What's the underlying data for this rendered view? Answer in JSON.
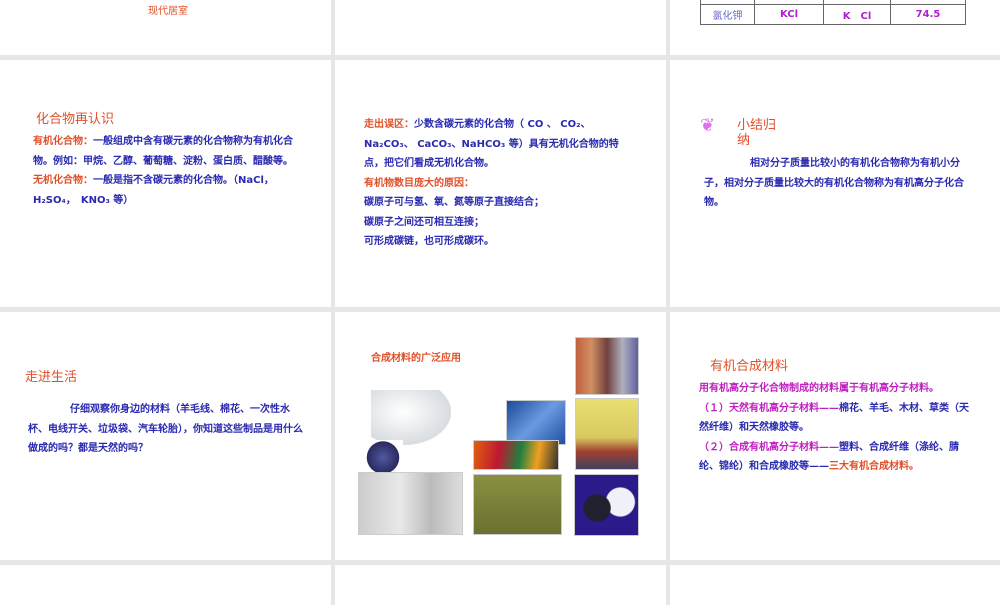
{
  "slide_top_left": {
    "caption": "现代居室"
  },
  "slide_top_right": {
    "table_row": [
      "氯化钾",
      "KCl",
      "K　Cl",
      "74.5"
    ]
  },
  "slide_compounds": {
    "title": "化合物再认识",
    "organic_label": "有机化合物：",
    "organic_text": "一般组成中含有碳元素的化合物称为有机化合物。例如：甲烷、乙醇、葡萄糖、淀粉、蛋白质、醋酸等。",
    "inorganic_label": "无机化合物：",
    "inorganic_text": "一般是指不含碳元素的化合物。（NaCl，H₂SO₄，　KNO₃ 等）"
  },
  "slide_misconception": {
    "label": "走出误区：",
    "text": "少数含碳元素的化合物（ CO 、 CO₂、Na₂CO₃、 CaCO₃、NaHCO₃ 等）具有无机化合物的特点，把它们看成无机化合物。",
    "reason_title": "有机物数目庞大的原因：",
    "reasons": [
      "碳原子可与氢、氧、氮等原子直接结合；",
      "碳原子之间还可相互连接；",
      "可形成碳链，也可形成碳环。"
    ]
  },
  "slide_summary": {
    "title": "小结归纳",
    "text": "相对分子质量比较小的有机化合物称为有机小分子，相对分子质量比较大的有机化合物称为有机高分子化合物。"
  },
  "slide_life": {
    "title": "走进生活",
    "text": "仔细观察你身边的材料（羊毛线、棉花、一次性水杯、电线开关、垃圾袋、汽车轮胎），你知道这些制品是用什么做成的吗？都是天然的吗？"
  },
  "slide_applications": {
    "title": "合成材料的广泛应用"
  },
  "slide_synthetic": {
    "title": "有机合成材料",
    "intro": "用有机高分子化合物制成的材料属于有机高分子材料。",
    "item1_label": "（１）天然有机高分子材料——",
    "item1_text": "棉花、羊毛、木材、草类（天然纤维）和天然橡胶等。",
    "item2_label": "（２）合成有机高分子材料——",
    "item2_text": "塑料、合成纤维（涤纶、腈纶、锦纶）和合成橡胶等——",
    "item2_highlight": "三大有机合成材料。"
  },
  "colors": {
    "title": "#e0502a",
    "body": "#2a2ab0",
    "magenta": "#c020c0"
  }
}
